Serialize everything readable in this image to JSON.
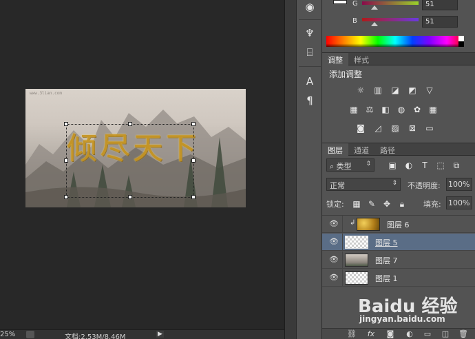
{
  "status_bar": {
    "zoom": "25%",
    "doc_info": "文档:2.53M/8.46M",
    "arrow": "▶"
  },
  "canvas": {
    "watermark_small": "www.3lian.com",
    "gold_text": "倾尽天下"
  },
  "color_panel": {
    "channels": [
      {
        "label": "G",
        "value": "51"
      },
      {
        "label": "B",
        "value": "51"
      }
    ]
  },
  "adjustments_panel": {
    "tabs": [
      "调整",
      "样式"
    ],
    "active_tab": "调整",
    "title": "添加调整",
    "icons": [
      [
        "brightness-icon",
        "levels-icon",
        "curves-icon",
        "exposure-icon",
        "vibrance-icon"
      ],
      [
        "hue-saturation-icon",
        "color-balance-icon",
        "black-white-icon",
        "photo-filter-icon",
        "channel-mixer-icon",
        "color-lookup-icon"
      ],
      [
        "invert-icon",
        "posterize-icon",
        "threshold-icon",
        "selective-color-icon",
        "gradient-map-icon"
      ]
    ]
  },
  "layers_panel": {
    "tabs": [
      "图层",
      "通道",
      "路径"
    ],
    "active_tab": "图层",
    "filter_kind": "类型",
    "blend_mode": "正常",
    "opacity_label": "不透明度:",
    "opacity_value": "100%",
    "lock_label": "锁定:",
    "fill_label": "填充:",
    "fill_value": "100%",
    "layers": [
      {
        "name": "图层 6",
        "thumb": "gold",
        "clipped": true,
        "selected": false
      },
      {
        "name": "图层 5",
        "thumb": "text",
        "clipped": false,
        "selected": true
      },
      {
        "name": "图层 7",
        "thumb": "landscape",
        "clipped": false,
        "selected": false
      },
      {
        "name": "图层 1",
        "thumb": "transparent",
        "clipped": false,
        "selected": false
      }
    ]
  },
  "watermark": {
    "logo": "Baidu 经验",
    "sub": "jingyan.baidu.com"
  },
  "colors": {
    "selected_layer": "#5a6d86",
    "panel_bg": "#535353",
    "workspace_bg": "#282828"
  }
}
